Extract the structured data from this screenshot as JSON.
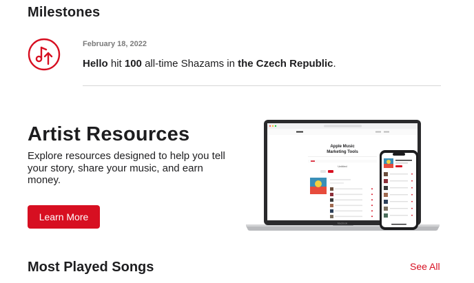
{
  "milestones": {
    "title": "Milestones",
    "icon": "music-note-up-arrow-icon",
    "item": {
      "date": "February 18, 2022",
      "song": "Hello",
      "text1": " hit ",
      "count": "100",
      "text2": " all-time Shazams in ",
      "place": "the Czech Republic",
      "text3": "."
    }
  },
  "artist_resources": {
    "title": "Artist Resources",
    "description": "Explore resources designed to help you tell your story, share your music, and earn money.",
    "button_label": "Learn More",
    "image": {
      "laptop_heading": "Apple Music Marketing Tools",
      "laptop_subheading": "Untitled",
      "laptop_brand": "MacBook"
    }
  },
  "most_played": {
    "title": "Most Played Songs",
    "see_all_label": "See All"
  },
  "colors": {
    "accent": "#d70f21",
    "text": "#1d1d1f",
    "muted": "#7a7a7a",
    "divider": "#d6d6d6"
  }
}
